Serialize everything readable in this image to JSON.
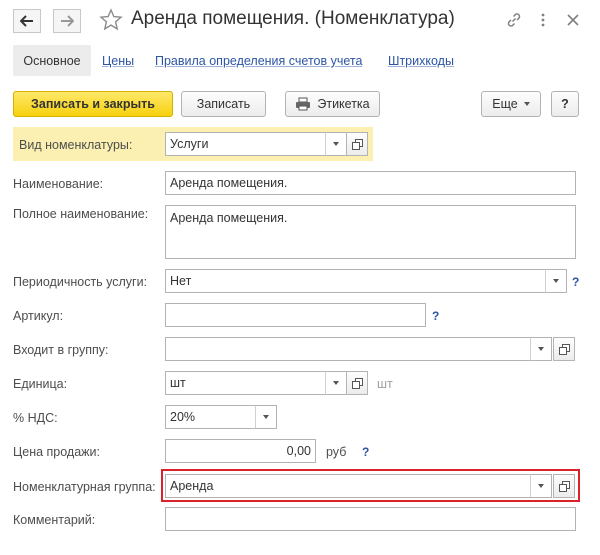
{
  "window": {
    "title": "Аренда помещения. (Номенклатура)",
    "icons": [
      "arrow-left-icon",
      "arrow-right-icon",
      "star-icon",
      "link-icon",
      "more-vertical-icon",
      "close-icon"
    ]
  },
  "tabs": [
    {
      "label": "Основное",
      "active": true
    },
    {
      "label": "Цены",
      "active": false
    },
    {
      "label": "Правила определения счетов учета",
      "active": false
    },
    {
      "label": "Штрихкоды",
      "active": false
    }
  ],
  "toolbar": {
    "save_close_label": "Записать и закрыть",
    "save_label": "Записать",
    "label_button": "Этикетка",
    "more_label": "Еще",
    "help_label": "?"
  },
  "form": {
    "kind_label": "Вид номенклатуры:",
    "kind_value": "Услуги",
    "name_label": "Наименование:",
    "name_value": "Аренда помещения.",
    "fullname_label": "Полное наименование:",
    "fullname_value": "Аренда помещения.",
    "periodicity_label": "Периодичность услуги:",
    "periodicity_value": "Нет",
    "article_label": "Артикул:",
    "article_value": "",
    "group_label": "Входит в группу:",
    "group_value": "",
    "unit_label": "Единица:",
    "unit_value": "шт",
    "unit_hint": "шт",
    "vat_label": "% НДС:",
    "vat_value": "20%",
    "price_label": "Цена продажи:",
    "price_value": "0,00",
    "price_currency": "руб",
    "nomgroup_label": "Номенклатурная группа:",
    "nomgroup_value": "Аренда",
    "comment_label": "Комментарий:",
    "comment_value": "",
    "help_mark": "?"
  },
  "colors": {
    "primary_button": "#f6d10d",
    "link": "#2c55a4",
    "highlight_row": "#fbf0b2",
    "highlight_border": "#d8232a"
  }
}
